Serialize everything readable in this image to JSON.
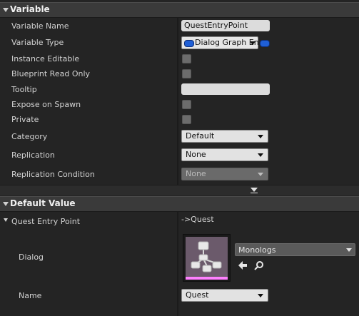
{
  "variable_section": {
    "title": "Variable",
    "variable_name": {
      "label": "Variable Name",
      "value": "QuestEntryPoint"
    },
    "variable_type": {
      "label": "Variable Type",
      "value": "Dialog Graph En"
    },
    "instance_editable": {
      "label": "Instance Editable"
    },
    "blueprint_read_only": {
      "label": "Blueprint Read Only"
    },
    "tooltip": {
      "label": "Tooltip",
      "value": ""
    },
    "expose_on_spawn": {
      "label": "Expose on Spawn"
    },
    "private": {
      "label": "Private"
    },
    "category": {
      "label": "Category",
      "value": "Default"
    },
    "replication": {
      "label": "Replication",
      "value": "None"
    },
    "replication_condition": {
      "label": "Replication Condition",
      "value": "None"
    }
  },
  "default_value_section": {
    "title": "Default Value",
    "struct_label": "Quest Entry Point",
    "struct_value": "->Quest",
    "dialog": {
      "label": "Dialog",
      "asset_name": "Monologs"
    },
    "name": {
      "label": "Name",
      "value": "Quest"
    }
  },
  "colors": {
    "panel_bg": "#242424",
    "header_bg": "#3a3a3a",
    "type_pin_blue": "#1f5fd6",
    "thumbnail_bg": "#6b5a6b",
    "thumbnail_border": "#ff80ff"
  }
}
